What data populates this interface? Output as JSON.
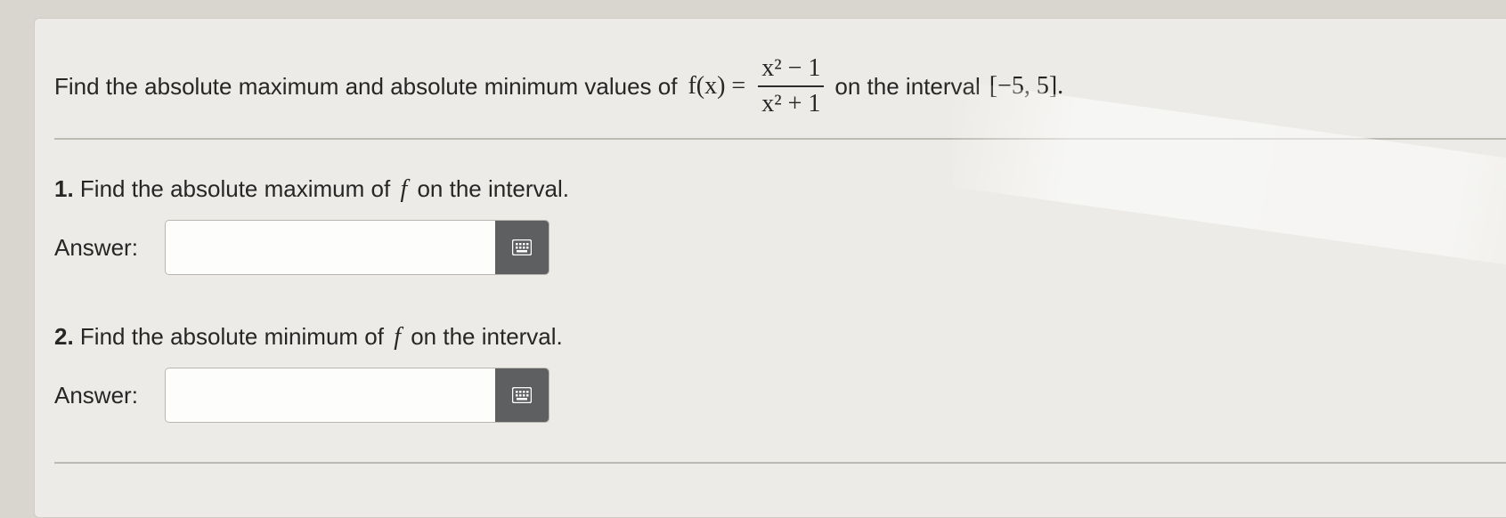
{
  "problem": {
    "prefix": "Find the absolute maximum and absolute minimum values of",
    "function_lhs": "f(x) =",
    "numerator": "x² − 1",
    "denominator": "x² + 1",
    "suffix": "on the interval",
    "interval": "[−5, 5]."
  },
  "questions": [
    {
      "number": "1.",
      "text_before": "Find the absolute maximum of",
      "variable": "f",
      "text_after": "on the interval.",
      "answer_label": "Answer:",
      "answer_value": ""
    },
    {
      "number": "2.",
      "text_before": "Find the absolute minimum of",
      "variable": "f",
      "text_after": "on the interval.",
      "answer_label": "Answer:",
      "answer_value": ""
    }
  ],
  "icons": {
    "keypad": "keypad-icon"
  },
  "colors": {
    "keypad_button": "#5e5f61",
    "card_background": "#ecebe7"
  }
}
